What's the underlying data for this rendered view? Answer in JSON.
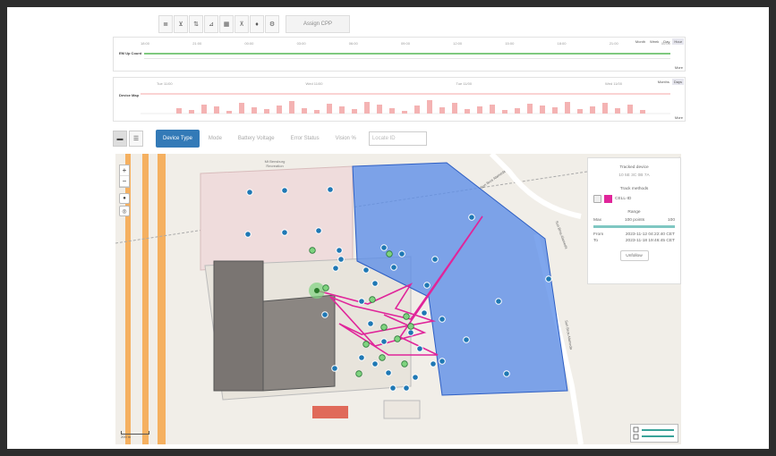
{
  "toolbar": {
    "icons": [
      "table-icon",
      "filter-icon",
      "sort-icon",
      "chart-icon",
      "grid-icon",
      "group-filter-icon",
      "bell-icon",
      "gear-icon"
    ],
    "glyphs": [
      "≣",
      "⊻",
      "⇅",
      "⊿",
      "▦",
      "⊼",
      "♦",
      "⚙"
    ],
    "assign_label": "Assign CPP"
  },
  "chart1": {
    "title": "EM Up Count",
    "scales": [
      "Month",
      "Week",
      "Day",
      "Hour"
    ],
    "active_scale": "Hour",
    "ticks": [
      "18:00",
      "21:00",
      "00:00",
      "03:00",
      "06:00",
      "09:00",
      "12:00",
      "15:00",
      "18:00",
      "21:00",
      "00:00"
    ],
    "more": "More"
  },
  "chart2": {
    "title": "Device Map",
    "scales": [
      "Months",
      "Days"
    ],
    "active_scale": "Days",
    "ticks": [
      "Tue 11/00",
      "Wed 11/00",
      "Tue 11/00",
      "Wed 11/00"
    ],
    "more": "More"
  },
  "filters": {
    "tabs": [
      "Device Type",
      "Mode",
      "Battery Voltage",
      "Error Status",
      "Vision %"
    ],
    "active": "Device Type",
    "search_placeholder": "Locate ID"
  },
  "map": {
    "zoom_in": "+",
    "zoom_out": "−",
    "street_labels": [
      "Sun Bros Alameda",
      "Sun Bros Alameda",
      "Sun Bros Alameda"
    ],
    "building_label": "Mt Bensburg Recreation",
    "scale_label": "200 m"
  },
  "info_panel": {
    "title": "Tracked device",
    "device_id": "10 5E 3C 0B 7A",
    "methods_title": "Track methods",
    "method_value": "CELL-ID",
    "range_title": "Range",
    "max_label": "Max",
    "max_value": "100 points",
    "max_right": "100",
    "from_label": "From",
    "from_value": "2023-11-12 04:22:40 CET",
    "to_label": "To",
    "to_value": "2023-11-18 19:46:45 CET",
    "btn": "Unfollow"
  },
  "colors": {
    "accent": "#337ab7",
    "zone": "#5b8de8",
    "track": "#e0259a",
    "marker": "#1f78b4",
    "marker_green": "#7fd37f",
    "bar": "#f4b3b3"
  }
}
